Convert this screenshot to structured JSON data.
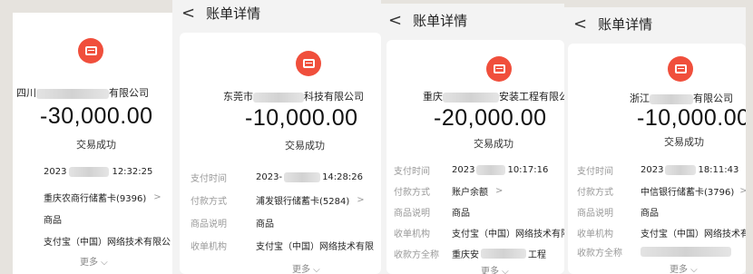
{
  "page": {
    "background": "#e6e3de",
    "logo_color": "#f04f3c"
  },
  "icons": {
    "logo": "alipay-merchant-logo-icon",
    "back": "back-arrow-icon",
    "chevron": "chevron-right-icon"
  },
  "common": {
    "title": "账单详情",
    "back_glyph": "<",
    "status": "交易成功",
    "more": "更多 ⌵",
    "chevron": ">",
    "labels": {
      "pay_time": "支付时间",
      "pay_method": "付款方式",
      "product_desc": "商品说明",
      "collector": "收单机构",
      "payee_name": "收款方全称"
    }
  },
  "receipts": [
    {
      "merchant_prefix": "四川",
      "merchant_suffix": "有限公司",
      "amount": "-30,000.00",
      "time_year": "2023",
      "time_clock": "12:32:25",
      "pay_method": "重庆农商行储蓄卡(9396)",
      "product": "商品",
      "collector": "支付宝（中国）网络技术有限公"
    },
    {
      "merchant_prefix": "东莞市",
      "merchant_suffix": "科技有限公司",
      "amount": "-10,000.00",
      "time_year": "2023-",
      "time_clock": "14:28:26",
      "pay_method": "浦发银行储蓄卡(5284)",
      "product": "商品",
      "collector": "支付宝（中国）网络技术有限"
    },
    {
      "merchant_prefix": "重庆",
      "merchant_suffix": "安装工程有限公",
      "amount": "-20,000.00",
      "time_year": "2023",
      "time_clock": "10:17:16",
      "pay_method": "账户余额",
      "product": "商品",
      "collector": "支付宝（中国）网络技术有限公",
      "payee_name_prefix": "重庆安",
      "payee_name_suffix": "工程"
    },
    {
      "merchant_prefix": "浙江",
      "merchant_suffix": "有限公司",
      "amount": "-10,000.00",
      "time_year": "2023",
      "time_clock": "18:11:43",
      "pay_method": "中信银行储蓄卡(3796)",
      "product": "商品",
      "collector": "支付宝（中国）网络技术有限公"
    }
  ]
}
